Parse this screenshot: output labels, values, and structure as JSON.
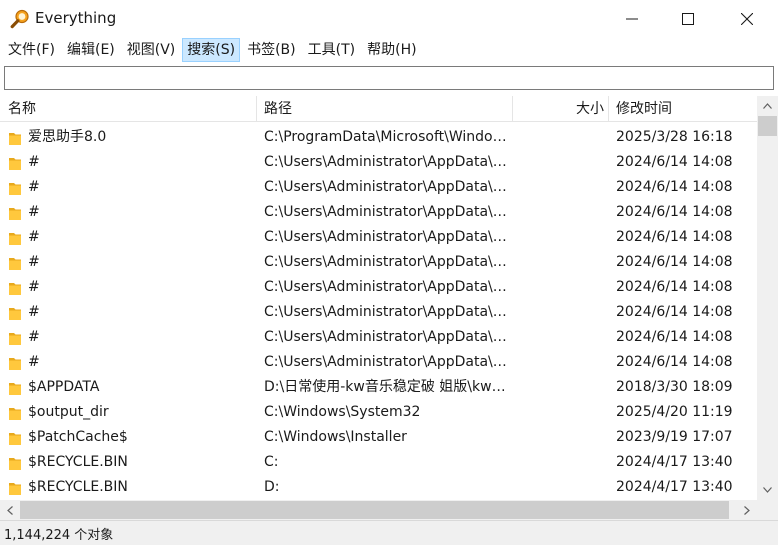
{
  "window": {
    "title": "Everything",
    "accent": "#cce8ff"
  },
  "menu": [
    {
      "label": "文件(F)"
    },
    {
      "label": "编辑(E)"
    },
    {
      "label": "视图(V)"
    },
    {
      "label": "搜索(S)",
      "active": true
    },
    {
      "label": "书签(B)"
    },
    {
      "label": "工具(T)"
    },
    {
      "label": "帮助(H)"
    }
  ],
  "search": {
    "value": "",
    "placeholder": ""
  },
  "columns": {
    "name": "名称",
    "path": "路径",
    "size": "大小",
    "modified": "修改时间"
  },
  "rows": [
    {
      "name": "爱思助手8.0",
      "path": "C:\\ProgramData\\Microsoft\\Windows\\Start Menu",
      "size": "",
      "modified": "2025/3/28 16:18",
      "icon": "folder-icon"
    },
    {
      "name": "#",
      "path": "C:\\Users\\Administrator\\AppData\\Local",
      "size": "",
      "modified": "2024/6/14 14:08",
      "icon": "folder-icon"
    },
    {
      "name": "#",
      "path": "C:\\Users\\Administrator\\AppData\\Local",
      "size": "",
      "modified": "2024/6/14 14:08",
      "icon": "folder-icon"
    },
    {
      "name": "#",
      "path": "C:\\Users\\Administrator\\AppData\\Local",
      "size": "",
      "modified": "2024/6/14 14:08",
      "icon": "folder-icon"
    },
    {
      "name": "#",
      "path": "C:\\Users\\Administrator\\AppData\\Local",
      "size": "",
      "modified": "2024/6/14 14:08",
      "icon": "folder-icon"
    },
    {
      "name": "#",
      "path": "C:\\Users\\Administrator\\AppData\\Local",
      "size": "",
      "modified": "2024/6/14 14:08",
      "icon": "folder-icon"
    },
    {
      "name": "#",
      "path": "C:\\Users\\Administrator\\AppData\\Local",
      "size": "",
      "modified": "2024/6/14 14:08",
      "icon": "folder-icon"
    },
    {
      "name": "#",
      "path": "C:\\Users\\Administrator\\AppData\\Local",
      "size": "",
      "modified": "2024/6/14 14:08",
      "icon": "folder-icon"
    },
    {
      "name": "#",
      "path": "C:\\Users\\Administrator\\AppData\\Local",
      "size": "",
      "modified": "2024/6/14 14:08",
      "icon": "folder-icon"
    },
    {
      "name": "#",
      "path": "C:\\Users\\Administrator\\AppData\\Local",
      "size": "",
      "modified": "2024/6/14 14:08",
      "icon": "folder-icon"
    },
    {
      "name": "$APPDATA",
      "path": "D:\\日常使用-kw音乐稳定破 姐版\\kwmusic",
      "size": "",
      "modified": "2018/3/30 18:09",
      "icon": "folder-icon"
    },
    {
      "name": "$output_dir",
      "path": "C:\\Windows\\System32",
      "size": "",
      "modified": "2025/4/20 11:19",
      "icon": "folder-icon"
    },
    {
      "name": "$PatchCache$",
      "path": "C:\\Windows\\Installer",
      "size": "",
      "modified": "2023/9/19 17:07",
      "icon": "folder-icon"
    },
    {
      "name": "$RECYCLE.BIN",
      "path": "C:",
      "size": "",
      "modified": "2024/4/17 13:40",
      "icon": "folder-icon"
    },
    {
      "name": "$RECYCLE.BIN",
      "path": "D:",
      "size": "",
      "modified": "2024/4/17 13:40",
      "icon": "folder-icon"
    }
  ],
  "status": {
    "text": "1,144,224 个对象"
  },
  "colors": {
    "folder": "#ffc83d",
    "folder_dark": "#e8a91c",
    "menu_active_bg": "#cce8ff",
    "scroll_thumb": "#cdcdcd"
  }
}
